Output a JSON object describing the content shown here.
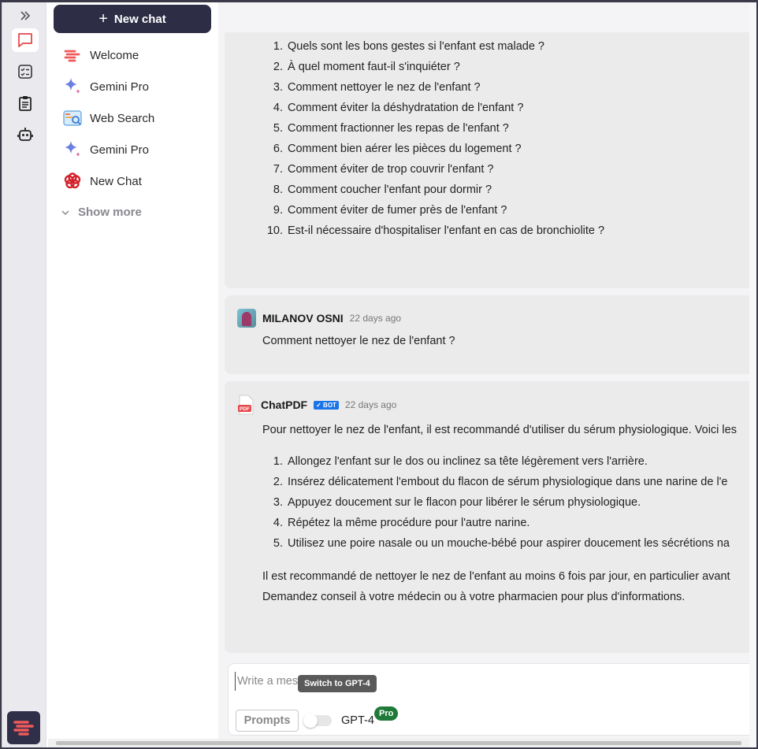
{
  "colors": {
    "accent": "#2d2d45",
    "bot_badge": "#1a73e8",
    "pro_badge": "#1f7a3a",
    "chat_icon": "#e5484d"
  },
  "rail": {
    "expand_icon": "double-chevron-right-icon",
    "items": [
      {
        "icon": "chat-bubble-icon",
        "active": true
      },
      {
        "icon": "checklist-icon",
        "active": false
      },
      {
        "icon": "clipboard-icon",
        "active": false
      },
      {
        "icon": "robot-icon",
        "active": false
      }
    ],
    "logo_icon": "app-logo-icon"
  },
  "sidebar": {
    "new_chat_label": "New chat",
    "items": [
      {
        "label": "Welcome",
        "icon": "welcome-logo-icon"
      },
      {
        "label": "Gemini Pro",
        "icon": "gemini-sparkle-icon"
      },
      {
        "label": "Web Search",
        "icon": "web-search-icon"
      },
      {
        "label": "Gemini Pro",
        "icon": "gemini-sparkle-icon"
      },
      {
        "label": "New Chat",
        "icon": "openai-flower-icon"
      }
    ],
    "show_more_label": "Show more"
  },
  "messages": {
    "first_list": [
      "Quels sont les bons gestes si l'enfant est malade ?",
      "À quel moment faut-il s'inquiéter ?",
      "Comment nettoyer le nez de l'enfant ?",
      "Comment éviter la déshydratation de l'enfant ?",
      "Comment fractionner les repas de l'enfant ?",
      "Comment bien aérer les pièces du logement ?",
      "Comment éviter de trop couvrir l'enfant ?",
      "Comment coucher l'enfant pour dormir ?",
      "Comment éviter de fumer près de l'enfant ?",
      "Est-il nécessaire d'hospitaliser l'enfant en cas de bronchiolite ?"
    ],
    "user_msg": {
      "author": "MILANOV OSNI",
      "time": "22 days ago",
      "text": "Comment nettoyer le nez de l'enfant ?"
    },
    "bot_msg": {
      "author": "ChatPDF",
      "badge": "✓ BOT",
      "time": "22 days ago",
      "intro": "Pour nettoyer le nez de l'enfant, il est recommandé d'utiliser du sérum physiologique. Voici les",
      "steps": [
        "Allongez l'enfant sur le dos ou inclinez sa tête légèrement vers l'arrière.",
        "Insérez délicatement l'embout du flacon de sérum physiologique dans une narine de l'e",
        "Appuyez doucement sur le flacon pour libérer le sérum physiologique.",
        "Répétez la même procédure pour l'autre narine.",
        "Utilisez une poire nasale ou un mouche-bébé pour aspirer doucement les sécrétions na"
      ],
      "outro1": "Il est recommandé de nettoyer le nez de l'enfant au moins 6 fois par jour, en particulier avant",
      "outro2": "Demandez conseil à votre médecin ou à votre pharmacien pour plus d'informations."
    }
  },
  "composer": {
    "placeholder": "Write a message",
    "tooltip": "Switch to GPT-4",
    "prompts_label": "Prompts",
    "gpt4_toggle_on": false,
    "model_label": "GPT-4",
    "pro_badge": "Pro"
  }
}
